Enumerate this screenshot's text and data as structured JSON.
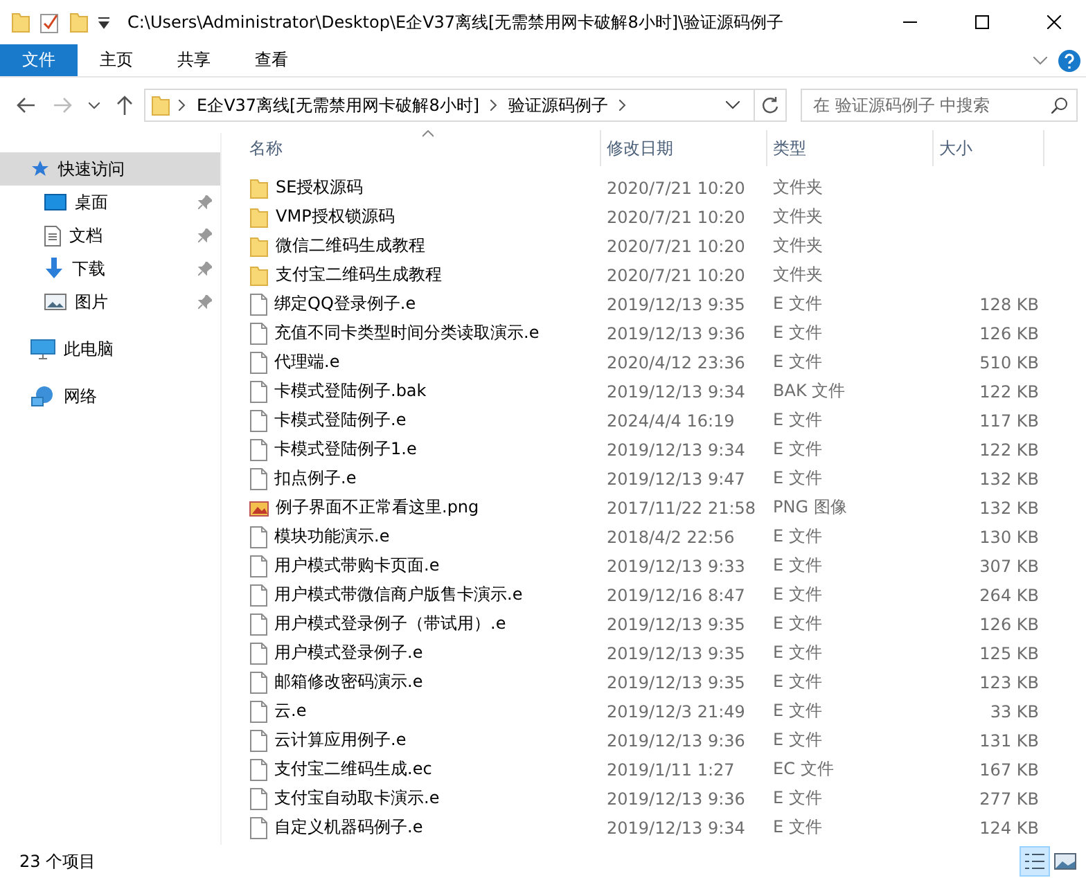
{
  "title_bar": {
    "path": "C:\\Users\\Administrator\\Desktop\\E企V37离线[无需禁用网卡破解8小时]\\验证源码例子"
  },
  "ribbon": {
    "file_button": "文件",
    "tabs": [
      "主页",
      "共享",
      "查看"
    ]
  },
  "address": {
    "crumbs": [
      "E企V37离线[无需禁用网卡破解8小时]",
      "验证源码例子"
    ],
    "search": {
      "placeholder": "在 验证源码例子 中搜索"
    }
  },
  "sidebar": {
    "items": [
      {
        "label": "快速访问",
        "kind": "star",
        "selected": true,
        "children": [
          {
            "label": "桌面",
            "kind": "desktop",
            "pinned": true
          },
          {
            "label": "文档",
            "kind": "document",
            "pinned": true
          },
          {
            "label": "下载",
            "kind": "download",
            "pinned": true
          },
          {
            "label": "图片",
            "kind": "picture",
            "pinned": true
          }
        ]
      },
      {
        "label": "此电脑",
        "kind": "pc",
        "selected": false
      },
      {
        "label": "网络",
        "kind": "network",
        "selected": false
      }
    ]
  },
  "table": {
    "columns": [
      {
        "label": "名称",
        "sorted": true
      },
      {
        "label": "修改日期",
        "sorted": false
      },
      {
        "label": "类型",
        "sorted": false
      },
      {
        "label": "大小",
        "sorted": false
      }
    ],
    "rows": [
      {
        "kind": "folder",
        "name": "SE授权源码",
        "date": "2020/7/21 10:20",
        "type": "文件夹"
      },
      {
        "kind": "folder",
        "name": "VMP授权锁源码",
        "date": "2020/7/21 10:20",
        "type": "文件夹"
      },
      {
        "kind": "folder",
        "name": "微信二维码生成教程",
        "date": "2020/7/21 10:20",
        "type": "文件夹"
      },
      {
        "kind": "folder",
        "name": "支付宝二维码生成教程",
        "date": "2020/7/21 10:20",
        "type": "文件夹"
      },
      {
        "kind": "file",
        "name": "绑定QQ登录例子.e",
        "date": "2019/12/13 9:35",
        "type": "E 文件",
        "size": "128 KB"
      },
      {
        "kind": "file",
        "name": "充值不同卡类型时间分类读取演示.e",
        "date": "2019/12/13 9:36",
        "type": "E 文件",
        "size": "126 KB"
      },
      {
        "kind": "file",
        "name": "代理端.e",
        "date": "2020/4/12 23:36",
        "type": "E 文件",
        "size": "510 KB"
      },
      {
        "kind": "file",
        "name": "卡模式登陆例子.bak",
        "date": "2019/12/13 9:34",
        "type": "BAK 文件",
        "size": "122 KB"
      },
      {
        "kind": "file",
        "name": "卡模式登陆例子.e",
        "date": "2024/4/4 16:19",
        "type": "E 文件",
        "size": "117 KB"
      },
      {
        "kind": "file",
        "name": "卡模式登陆例子1.e",
        "date": "2019/12/13 9:34",
        "type": "E 文件",
        "size": "122 KB"
      },
      {
        "kind": "file",
        "name": "扣点例子.e",
        "date": "2019/12/13 9:47",
        "type": "E 文件",
        "size": "132 KB"
      },
      {
        "kind": "image",
        "name": "例子界面不正常看这里.png",
        "date": "2017/11/22 21:58",
        "type": "PNG 图像",
        "size": "132 KB"
      },
      {
        "kind": "file",
        "name": "模块功能演示.e",
        "date": "2018/4/2 22:56",
        "type": "E 文件",
        "size": "130 KB"
      },
      {
        "kind": "file",
        "name": "用户模式带购卡页面.e",
        "date": "2019/12/13 9:33",
        "type": "E 文件",
        "size": "307 KB"
      },
      {
        "kind": "file",
        "name": "用户模式带微信商户版售卡演示.e",
        "date": "2019/12/16 8:47",
        "type": "E 文件",
        "size": "264 KB"
      },
      {
        "kind": "file",
        "name": "用户模式登录例子（带试用）.e",
        "date": "2019/12/13 9:35",
        "type": "E 文件",
        "size": "126 KB"
      },
      {
        "kind": "file",
        "name": "用户模式登录例子.e",
        "date": "2019/12/13 9:35",
        "type": "E 文件",
        "size": "125 KB"
      },
      {
        "kind": "file",
        "name": "邮箱修改密码演示.e",
        "date": "2019/12/13 9:35",
        "type": "E 文件",
        "size": "123 KB"
      },
      {
        "kind": "file",
        "name": "云.e",
        "date": "2019/12/3 21:49",
        "type": "E 文件",
        "size": "33 KB"
      },
      {
        "kind": "file",
        "name": "云计算应用例子.e",
        "date": "2019/12/13 9:36",
        "type": "E 文件",
        "size": "131 KB"
      },
      {
        "kind": "file",
        "name": "支付宝二维码生成.ec",
        "date": "2019/1/11 1:27",
        "type": "EC 文件",
        "size": "167 KB"
      },
      {
        "kind": "file",
        "name": "支付宝自动取卡演示.e",
        "date": "2019/12/13 9:36",
        "type": "E 文件",
        "size": "277 KB"
      },
      {
        "kind": "file",
        "name": "自定义机器码例子.e",
        "date": "2019/12/13 9:34",
        "type": "E 文件",
        "size": "124 KB"
      }
    ]
  },
  "status_bar": {
    "count": "23 个项目",
    "views": [
      {
        "kind": "details",
        "selected": true
      },
      {
        "kind": "tiles",
        "selected": false
      }
    ]
  }
}
